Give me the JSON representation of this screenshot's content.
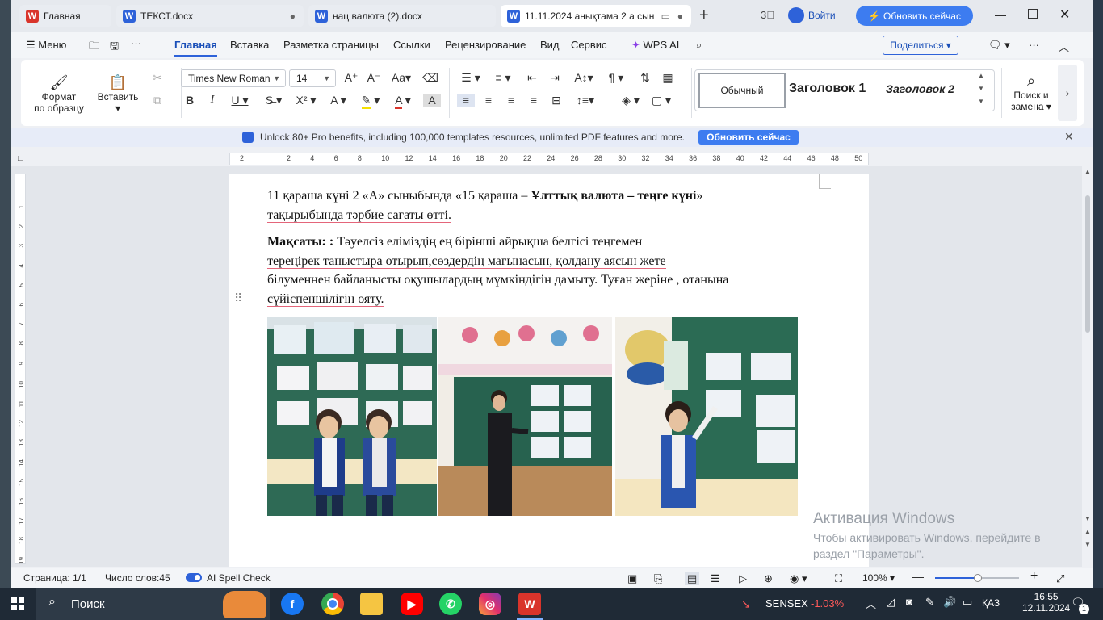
{
  "tabs": [
    {
      "label": "Главная",
      "icon": "wps-home-icon"
    },
    {
      "label": "ТЕКСТ.docx",
      "icon": "word-doc-icon"
    },
    {
      "label": "нац валюта (2).docx",
      "icon": "word-doc-icon"
    },
    {
      "label": "11.11.2024 анықтама 2 а сын",
      "icon": "word-doc-icon"
    }
  ],
  "titlebar": {
    "login": "Войти",
    "upgrade": "Обновить сейчас"
  },
  "menu": {
    "menu_label": "Меню",
    "items": [
      "Главная",
      "Вставка",
      "Разметка страницы",
      "Ссылки",
      "Рецензирование",
      "Вид",
      "Сервис"
    ],
    "wps_ai": "WPS AI",
    "share": "Поделиться"
  },
  "ribbon": {
    "format_painter": [
      "Формат",
      "по образцу"
    ],
    "paste": "Вставить",
    "font_name": "Times New Roman",
    "font_size": "14",
    "styles": [
      "Обычный",
      "Заголовок 1",
      "Заголовок 2"
    ],
    "find_replace": [
      "Поиск и",
      "замена"
    ]
  },
  "banner": {
    "text": "Unlock 80+ Pro benefits, including 100,000 templates resources, unlimited PDF features and more.",
    "button": "Обновить сейчас"
  },
  "ruler": {
    "marks": [
      "2",
      "2",
      "4",
      "6",
      "8",
      "10",
      "12",
      "14",
      "16",
      "18",
      "20",
      "22",
      "24",
      "26",
      "28",
      "30",
      "32",
      "34",
      "36",
      "38",
      "40",
      "42",
      "44",
      "46",
      "48",
      "50"
    ]
  },
  "vruler": {
    "marks": [
      "1",
      "2",
      "3",
      "4",
      "5",
      "6",
      "7",
      "8",
      "9",
      "10",
      "11",
      "12",
      "13",
      "14",
      "15",
      "16",
      "17",
      "18",
      "19"
    ]
  },
  "document": {
    "p1_line1_a": "11 қараша күні 2 «А» сыныбында «15 қараша – ",
    "p1_line1_b": "Ұлттық валюта – теңге күні",
    "p1_line1_c": "»",
    "p1_line2": "тақырыбында тәрбие сағаты өтті.",
    "p2_label": "Мақсаты: :",
    "p2_line1": " Тәуелсіз еліміздің  ең  бірінші  айрықша белгісі  теңгемен",
    "p2_line2": "тереңірек  таныстыра отырып,сөздердің мағынасын, қолдану аясын  жете",
    "p2_line3": "білуменнен  байланысты оқушылардың мүмкіндігін дамыту. Туған жеріне , отанына",
    "p2_line4": "сүйіспеншілігін ояту."
  },
  "watermark": {
    "title": "Активация Windows",
    "line1": "Чтобы активировать Windows, перейдите в",
    "line2": "раздел \"Параметры\"."
  },
  "status": {
    "page": "Страница: 1/1",
    "words": "Число слов:45",
    "spell": "AI Spell Check",
    "zoom": "100%"
  },
  "taskbar": {
    "search": "Поиск",
    "stock_name": "SENSEX",
    "stock_change": "-1.03%",
    "lang": "ҚАЗ",
    "time": "16:55",
    "date": "12.11.2024",
    "notifications": "1"
  },
  "colors": {
    "accent": "#2e62d9",
    "wps_red": "#d9342b",
    "stock_down": "#ff5a5a"
  }
}
